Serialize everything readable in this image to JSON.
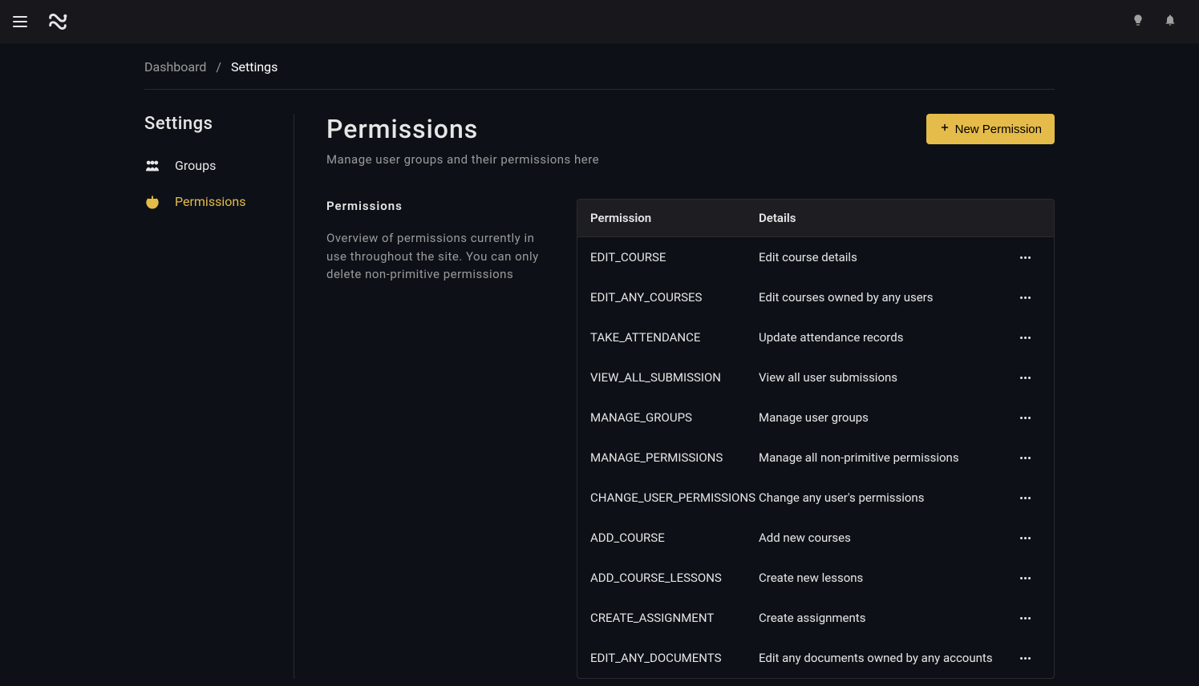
{
  "breadcrumb": {
    "dashboard": "Dashboard",
    "separator": "/",
    "current": "Settings"
  },
  "sidebar": {
    "title": "Settings",
    "items": [
      {
        "label": "Groups",
        "icon": "users-icon",
        "active": false
      },
      {
        "label": "Permissions",
        "icon": "power-icon",
        "active": true
      }
    ]
  },
  "page": {
    "title": "Permissions",
    "subtitle": "Manage user groups and their permissions here",
    "newButtonLabel": "New Permission"
  },
  "section": {
    "heading": "Permissions",
    "description": "Overview of permissions currently in use throughout the site. You can only delete non-primitive permissions"
  },
  "table": {
    "headers": {
      "permission": "Permission",
      "details": "Details"
    },
    "rows": [
      {
        "permission": "EDIT_COURSE",
        "details": "Edit course details"
      },
      {
        "permission": "EDIT_ANY_COURSES",
        "details": "Edit courses owned by any users"
      },
      {
        "permission": "TAKE_ATTENDANCE",
        "details": "Update attendance records"
      },
      {
        "permission": "VIEW_ALL_SUBMISSION",
        "details": "View all user submissions"
      },
      {
        "permission": "MANAGE_GROUPS",
        "details": "Manage user groups"
      },
      {
        "permission": "MANAGE_PERMISSIONS",
        "details": "Manage all non-primitive permissions"
      },
      {
        "permission": "CHANGE_USER_PERMISSIONS",
        "details": "Change any user's permissions"
      },
      {
        "permission": "ADD_COURSE",
        "details": "Add new courses"
      },
      {
        "permission": "ADD_COURSE_LESSONS",
        "details": "Create new lessons"
      },
      {
        "permission": "CREATE_ASSIGNMENT",
        "details": "Create assignments"
      },
      {
        "permission": "EDIT_ANY_DOCUMENTS",
        "details": "Edit any documents owned by any accounts"
      }
    ]
  }
}
